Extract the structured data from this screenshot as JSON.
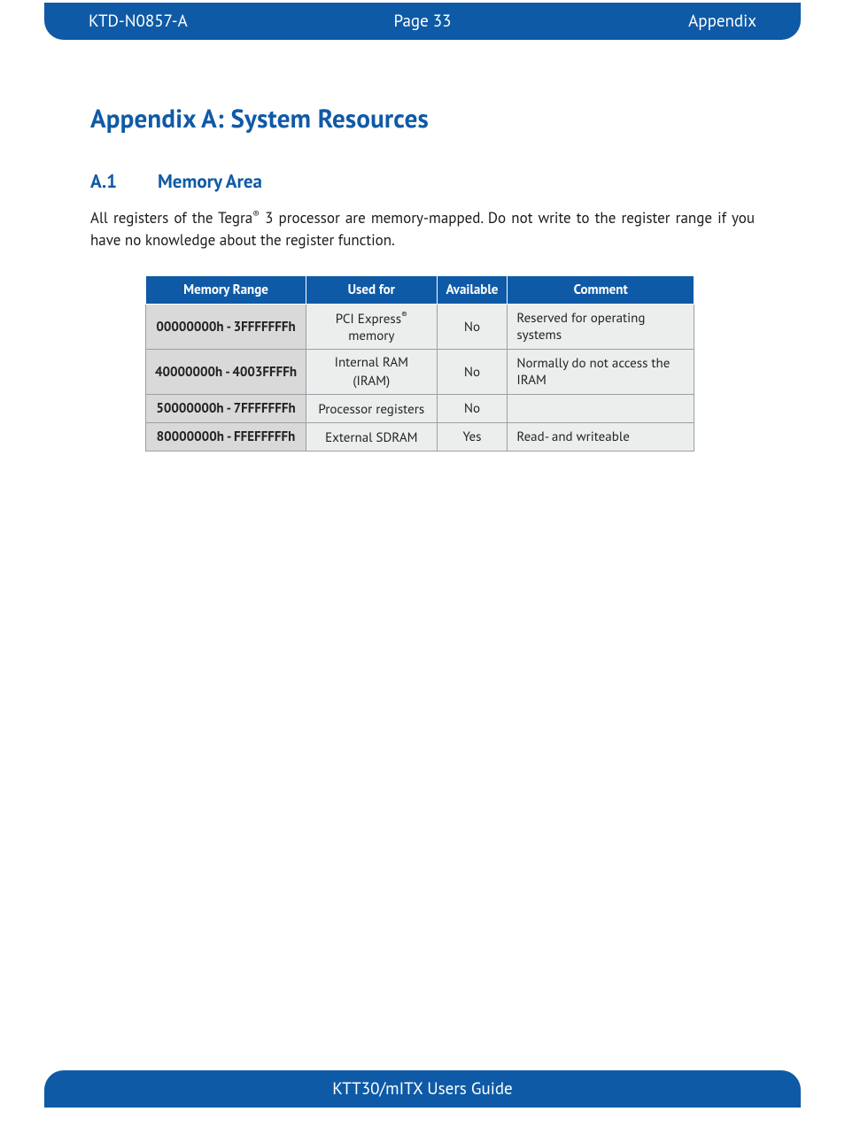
{
  "header": {
    "doc_id": "KTD-N0857-A",
    "page_label": "Page 33",
    "section": "Appendix"
  },
  "title": "Appendix A: System Resources",
  "section_a1": {
    "num": "A.1",
    "heading": "Memory Area",
    "para_pre": "All registers of the Tegra",
    "para_sup": "®",
    "para_post": " 3 processor are memory-mapped. Do not write to the register range if you have no knowledge about the register function."
  },
  "table": {
    "headers": {
      "range": "Memory Range",
      "used": "Used for",
      "avail": "Available",
      "comment": "Comment"
    },
    "rows": [
      {
        "range": "00000000h - 3FFFFFFFh",
        "used_pre": "PCI Express",
        "used_sup": "®",
        "used_post": " memory",
        "avail": "No",
        "comment": "Reserved for operating systems"
      },
      {
        "range": "40000000h - 4003FFFFh",
        "used_pre": "Internal RAM (IRAM)",
        "used_sup": "",
        "used_post": "",
        "avail": "No",
        "comment": "Normally do not access the IRAM"
      },
      {
        "range": "50000000h - 7FFFFFFFh",
        "used_pre": "Processor registers",
        "used_sup": "",
        "used_post": "",
        "avail": "No",
        "comment": ""
      },
      {
        "range": "80000000h - FFEFFFFFh",
        "used_pre": "External SDRAM",
        "used_sup": "",
        "used_post": "",
        "avail": "Yes",
        "comment": "Read- and writeable"
      }
    ]
  },
  "footer": {
    "guide": "KTT30/mITX Users Guide"
  }
}
